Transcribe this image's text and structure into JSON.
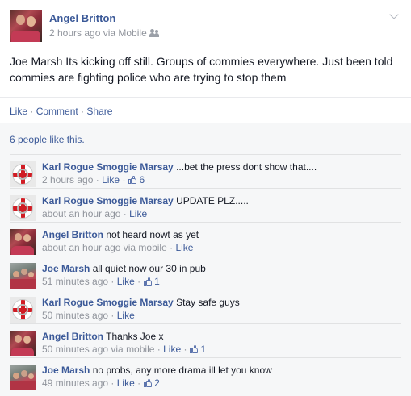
{
  "post": {
    "author": "Angel Britton",
    "meta": "2 hours ago via Mobile",
    "audience_icon": "friends-icon",
    "text": "Joe Marsh Its kicking off still. Groups of commies everywhere. Just been told commies are fighting police who are trying to stop them",
    "actions": {
      "like": "Like",
      "comment": "Comment",
      "share": "Share",
      "separator": "·"
    }
  },
  "likes_summary": "6 people like this.",
  "comments": [
    {
      "author": "Karl Rogue Smoggie Marsay",
      "text": "...bet the press dont show that....",
      "time": "2 hours ago",
      "like_label": "Like",
      "like_count": "6",
      "avatar": "flag"
    },
    {
      "author": "Karl Rogue Smoggie Marsay",
      "text": "UPDATE PLZ.....",
      "time": "about an hour ago",
      "like_label": "Like",
      "like_count": "",
      "avatar": "flag"
    },
    {
      "author": "Angel Britton",
      "text": "not heard nowt as yet",
      "time": "about an hour ago via mobile",
      "like_label": "Like",
      "like_count": "",
      "avatar": "photo"
    },
    {
      "author": "Joe Marsh",
      "text": "all quiet now our 30 in pub",
      "time": "51 minutes ago",
      "like_label": "Like",
      "like_count": "1",
      "avatar": "crowd"
    },
    {
      "author": "Karl Rogue Smoggie Marsay",
      "text": "Stay safe guys",
      "time": "50 minutes ago",
      "like_label": "Like",
      "like_count": "",
      "avatar": "flag"
    },
    {
      "author": "Angel Britton",
      "text": "Thanks Joe x",
      "time": "50 minutes ago via mobile",
      "like_label": "Like",
      "like_count": "1",
      "avatar": "photo"
    },
    {
      "author": "Joe Marsh",
      "text": "no probs, any more drama ill let you know",
      "time": "49 minutes ago",
      "like_label": "Like",
      "like_count": "2",
      "avatar": "crowd"
    }
  ],
  "colors": {
    "link": "#3b5998",
    "meta": "#90949c",
    "ufi_background": "#f6f7f8"
  }
}
